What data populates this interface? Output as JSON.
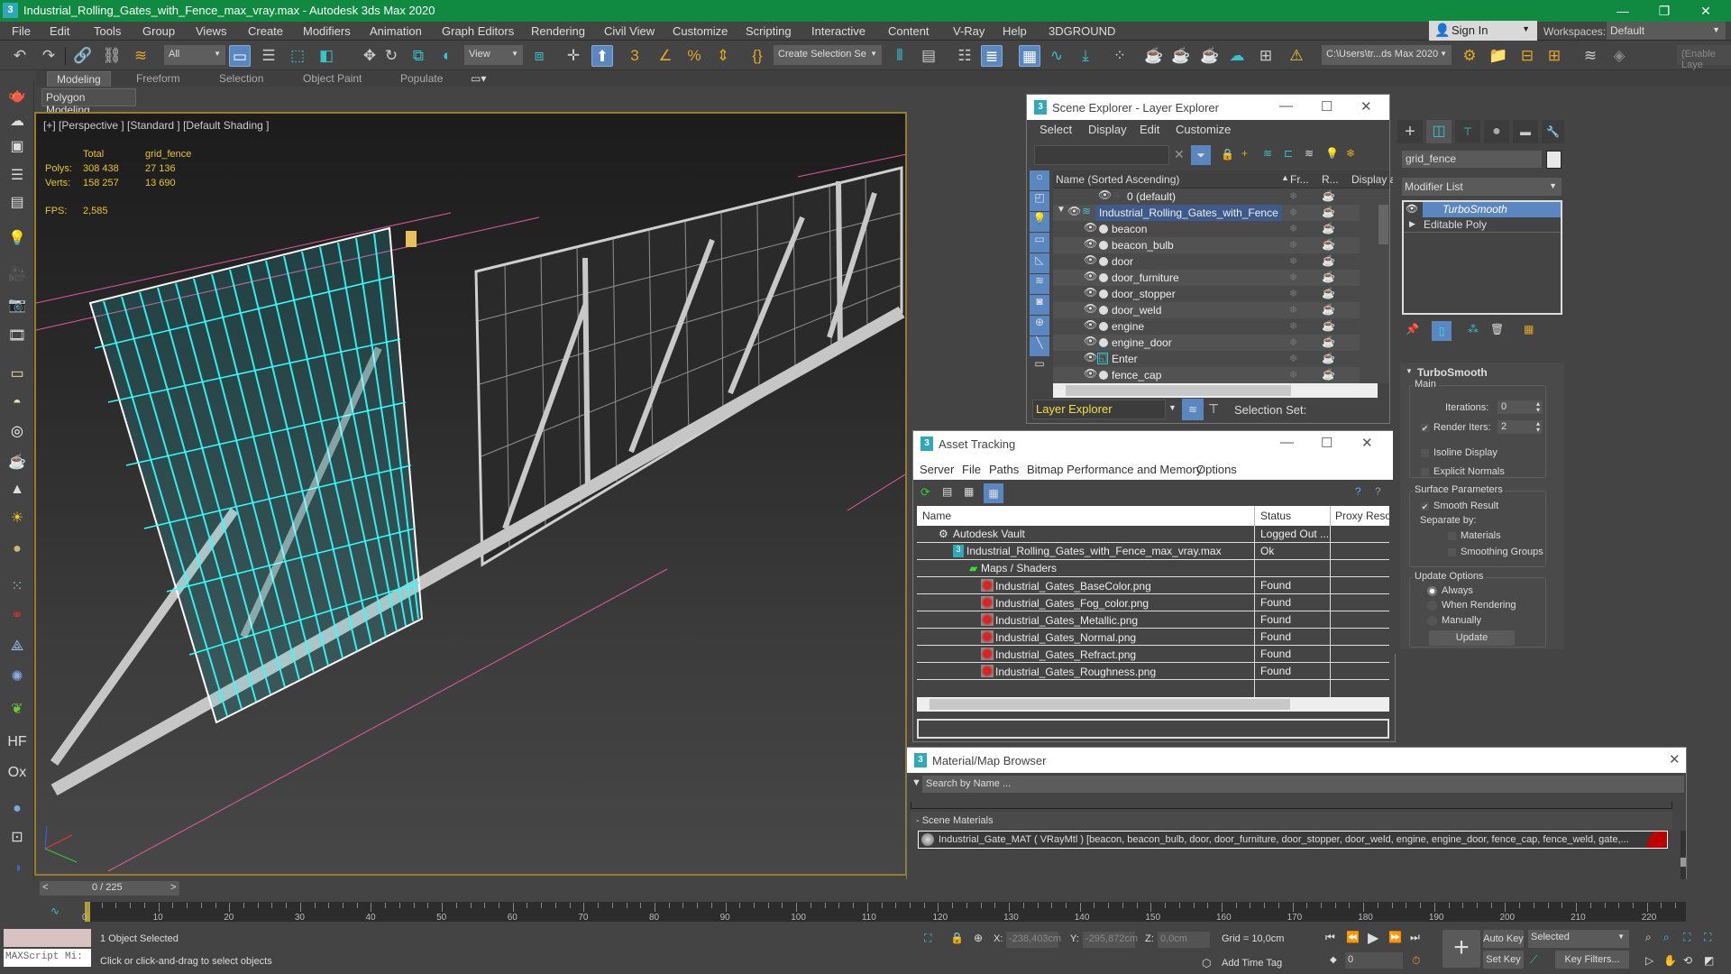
{
  "window": {
    "title": "Industrial_Rolling_Gates_with_Fence_max_vray.max - Autodesk 3ds Max 2020",
    "app_icon": "3",
    "controls": {
      "minimize": "—",
      "restore": "❐",
      "close": "✕"
    }
  },
  "menu": [
    "File",
    "Edit",
    "Tools",
    "Group",
    "Views",
    "Create",
    "Modifiers",
    "Animation",
    "Graph Editors",
    "Rendering",
    "Civil View",
    "Customize",
    "Scripting",
    "Interactive",
    "Content",
    "V-Ray",
    "Help",
    "3DGROUND"
  ],
  "account": {
    "sign_in": "Sign In",
    "workspaces_label": "Workspaces:",
    "workspace": "Default"
  },
  "toolbar": {
    "selection_filter": "All",
    "ref_coord": "View",
    "named_selection": "Create Selection Se",
    "project_path": "C:\\Users\\tr...ds Max 2020",
    "layer_field_placeholder": "(Enable Laye"
  },
  "ribbon": {
    "tabs": [
      "Modeling",
      "Freeform",
      "Selection",
      "Object Paint",
      "Populate"
    ],
    "active_tab": "Modeling",
    "panel": "Polygon Modeling"
  },
  "viewport": {
    "label": "[+] [Perspective ] [Standard ] [Default Shading ]",
    "stats": {
      "col_total": "Total",
      "col_object": "grid_fence",
      "polys_label": "Polys:",
      "polys_total": "308 438",
      "polys_object": "27 136",
      "verts_label": "Verts:",
      "verts_total": "158 257",
      "verts_object": "13 690",
      "fps_label": "FPS:",
      "fps": "2,585"
    }
  },
  "scene_explorer": {
    "title": "Scene Explorer - Layer Explorer",
    "menu": [
      "Select",
      "Display",
      "Edit",
      "Customize"
    ],
    "columns": [
      "Name (Sorted Ascending)",
      "Fr...",
      "R...",
      "Display as"
    ],
    "rows": [
      {
        "name": "0 (default)",
        "type": "layer",
        "level": 0
      },
      {
        "name": "Industrial_Rolling_Gates_with_Fence",
        "type": "layer",
        "level": 0,
        "selected": true,
        "expanded": true
      },
      {
        "name": "beacon",
        "type": "object",
        "level": 1
      },
      {
        "name": "beacon_bulb",
        "type": "object",
        "level": 1
      },
      {
        "name": "door",
        "type": "object",
        "level": 1
      },
      {
        "name": "door_furniture",
        "type": "object",
        "level": 1
      },
      {
        "name": "door_stopper",
        "type": "object",
        "level": 1
      },
      {
        "name": "door_weld",
        "type": "object",
        "level": 1
      },
      {
        "name": "engine",
        "type": "object",
        "level": 1
      },
      {
        "name": "engine_door",
        "type": "object",
        "level": 1
      },
      {
        "name": "Enter",
        "type": "helper",
        "level": 1
      },
      {
        "name": "fence_cap",
        "type": "object",
        "level": 1
      }
    ],
    "footer_mode": "Layer Explorer",
    "selection_set_label": "Selection Set:"
  },
  "asset_tracking": {
    "title": "Asset Tracking",
    "menu": [
      "Server",
      "File",
      "Paths",
      "Bitmap Performance and Memory",
      "Options"
    ],
    "columns": [
      "Name",
      "Status",
      "Proxy Reso"
    ],
    "rows": [
      {
        "name": "Autodesk Vault",
        "status": "Logged Out ...",
        "level": 0,
        "icon": "vault-icon"
      },
      {
        "name": "Industrial_Rolling_Gates_with_Fence_max_vray.max",
        "status": "Ok",
        "level": 1,
        "icon": "max-file-icon"
      },
      {
        "name": "Maps / Shaders",
        "status": "",
        "level": 2,
        "icon": "maps-icon"
      },
      {
        "name": "Industrial_Gates_BaseColor.png",
        "status": "Found",
        "level": 3,
        "icon": "bitmap-icon"
      },
      {
        "name": "Industrial_Gates_Fog_color.png",
        "status": "Found",
        "level": 3,
        "icon": "bitmap-icon"
      },
      {
        "name": "Industrial_Gates_Metallic.png",
        "status": "Found",
        "level": 3,
        "icon": "bitmap-icon"
      },
      {
        "name": "Industrial_Gates_Normal.png",
        "status": "Found",
        "level": 3,
        "icon": "bitmap-icon"
      },
      {
        "name": "Industrial_Gates_Refract.png",
        "status": "Found",
        "level": 3,
        "icon": "bitmap-icon"
      },
      {
        "name": "Industrial_Gates_Roughness.png",
        "status": "Found",
        "level": 3,
        "icon": "bitmap-icon"
      }
    ]
  },
  "material_browser": {
    "title": "Material/Map Browser",
    "search_placeholder": "Search by Name ...",
    "section": "- Scene Materials",
    "material": "Industrial_Gate_MAT ( VRayMtl ) [beacon, beacon_bulb, door, door_furniture, door_stopper, door_weld, engine, engine_door, fence_cap, fence_weld, gate,..."
  },
  "command_panel": {
    "object_name": "grid_fence",
    "object_color": "#e8e8e8",
    "modifier_list": "Modifier List",
    "stack": [
      {
        "name": "TurboSmooth",
        "selected": true
      },
      {
        "name": "Editable Poly",
        "selected": false
      }
    ],
    "rollout": {
      "title": "TurboSmooth",
      "main_label": "Main",
      "iterations_label": "Iterations:",
      "iterations": "0",
      "render_iters_label": "Render Iters:",
      "render_iters": "2",
      "render_iters_checked": true,
      "isoline_label": "Isoline Display",
      "isoline_checked": false,
      "explicit_normals_label": "Explicit Normals",
      "explicit_normals_checked": false,
      "surface_label": "Surface Parameters",
      "smooth_result_label": "Smooth Result",
      "smooth_result_checked": true,
      "separate_by_label": "Separate by:",
      "materials_label": "Materials",
      "smoothing_groups_label": "Smoothing Groups",
      "update_options_label": "Update Options",
      "update_always": "Always",
      "update_rendering": "When Rendering",
      "update_manually": "Manually",
      "update_selected": "Always",
      "update_button": "Update"
    }
  },
  "timeline": {
    "frame_display": "0 / 225",
    "current_frame": 0,
    "total_frames": 225,
    "ticks": [
      "0",
      "10",
      "20",
      "30",
      "40",
      "50",
      "60",
      "70",
      "80",
      "90",
      "100",
      "110",
      "120",
      "130",
      "140",
      "150",
      "160",
      "170",
      "180",
      "190",
      "200",
      "210",
      "220"
    ]
  },
  "status": {
    "selection": "1 Object Selected",
    "prompt": "Click or click-and-drag to select objects",
    "maxscript_placeholder": "MAXScript Mi:",
    "x_label": "X:",
    "x": "-238,403cm",
    "y_label": "Y:",
    "y": "-295,872cm",
    "z_label": "Z:",
    "z": "0,0cm",
    "grid": "Grid = 10,0cm",
    "add_time_tag": "Add Time Tag",
    "frame_field": "0",
    "auto_key": "Auto Key",
    "set_key": "Set Key",
    "key_mode": "Selected",
    "key_filters": "Key Filters..."
  },
  "colors": {
    "titlebar": "#108a40",
    "selection_highlight": "#5b87c0",
    "viewport_border": "#9a7b2a",
    "stats_text": "#e6c32b",
    "wireframe_selected": "#33ffff"
  }
}
